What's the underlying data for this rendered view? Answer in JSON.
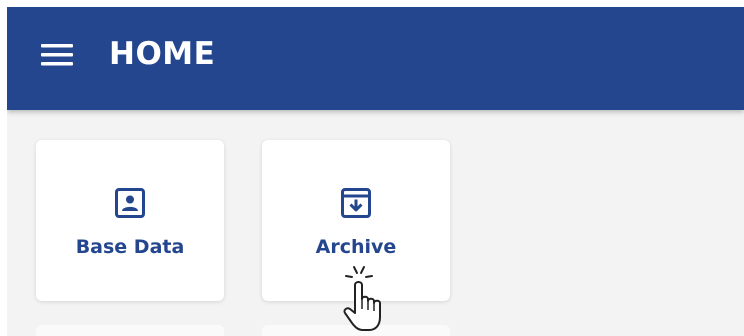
{
  "header": {
    "title": "HOME",
    "menu_icon": "menu-icon",
    "background_color": "#23468e"
  },
  "tiles": [
    {
      "label": "Base Data",
      "icon": "contact-card-icon"
    },
    {
      "label": "Archive",
      "icon": "archive-download-icon"
    }
  ],
  "colors": {
    "accent": "#23468e",
    "page_background": "#f3f3f3",
    "tile_background": "#ffffff"
  },
  "cursor": {
    "icon": "hand-pointer-click-icon"
  }
}
